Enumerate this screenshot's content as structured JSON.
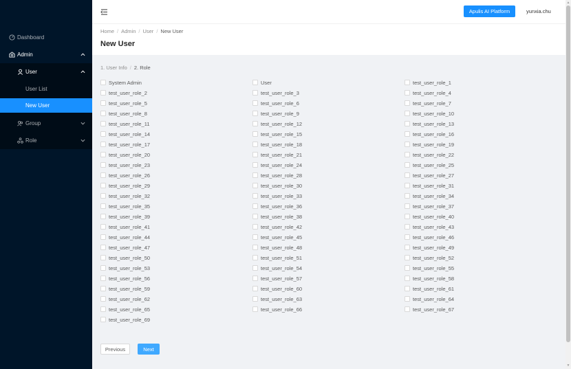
{
  "sidebar": {
    "dashboard": "Dashboard",
    "admin": "Admin",
    "user": "User",
    "user_list": "User List",
    "new_user": "New User",
    "group": "Group",
    "role": "Role"
  },
  "header": {
    "platform_button": "Apulis AI Platform",
    "username": "yunxia.chu"
  },
  "breadcrumb": [
    "Home",
    "Admin",
    "User",
    "New User"
  ],
  "page_title": "New User",
  "steps": [
    "1. User Info",
    "2. Role"
  ],
  "roles": [
    "System Admin",
    "User",
    "test_user_role_1",
    "test_user_role_2",
    "test_user_role_3",
    "test_user_role_4",
    "test_user_role_5",
    "test_user_role_6",
    "test_user_role_7",
    "test_user_role_8",
    "test_user_role_9",
    "test_user_role_10",
    "test_user_role_11",
    "test_user_role_12",
    "test_user_role_13",
    "test_user_role_14",
    "test_user_role_15",
    "test_user_role_16",
    "test_user_role_17",
    "test_user_role_18",
    "test_user_role_19",
    "test_user_role_20",
    "test_user_role_21",
    "test_user_role_22",
    "test_user_role_23",
    "test_user_role_24",
    "test_user_role_25",
    "test_user_role_26",
    "test_user_role_28",
    "test_user_role_27",
    "test_user_role_29",
    "test_user_role_30",
    "test_user_role_31",
    "test_user_role_32",
    "test_user_role_33",
    "test_user_role_34",
    "test_user_role_35",
    "test_user_role_36",
    "test_user_role_37",
    "test_user_role_39",
    "test_user_role_38",
    "test_user_role_40",
    "test_user_role_41",
    "test_user_role_42",
    "test_user_role_43",
    "test_user_role_44",
    "test_user_role_45",
    "test_user_role_46",
    "test_user_role_47",
    "test_user_role_48",
    "test_user_role_49",
    "test_user_role_50",
    "test_user_role_51",
    "test_user_role_52",
    "test_user_role_53",
    "test_user_role_54",
    "test_user_role_55",
    "test_user_role_56",
    "test_user_role_57",
    "test_user_role_58",
    "test_user_role_59",
    "test_user_role_60",
    "test_user_role_61",
    "test_user_role_62",
    "test_user_role_63",
    "test_user_role_64",
    "test_user_role_65",
    "test_user_role_66",
    "test_user_role_67",
    "test_user_role_69"
  ],
  "buttons": {
    "previous": "Previous",
    "next": "Next"
  },
  "colors": {
    "sidebar_bg": "#001529",
    "primary": "#1890ff"
  }
}
